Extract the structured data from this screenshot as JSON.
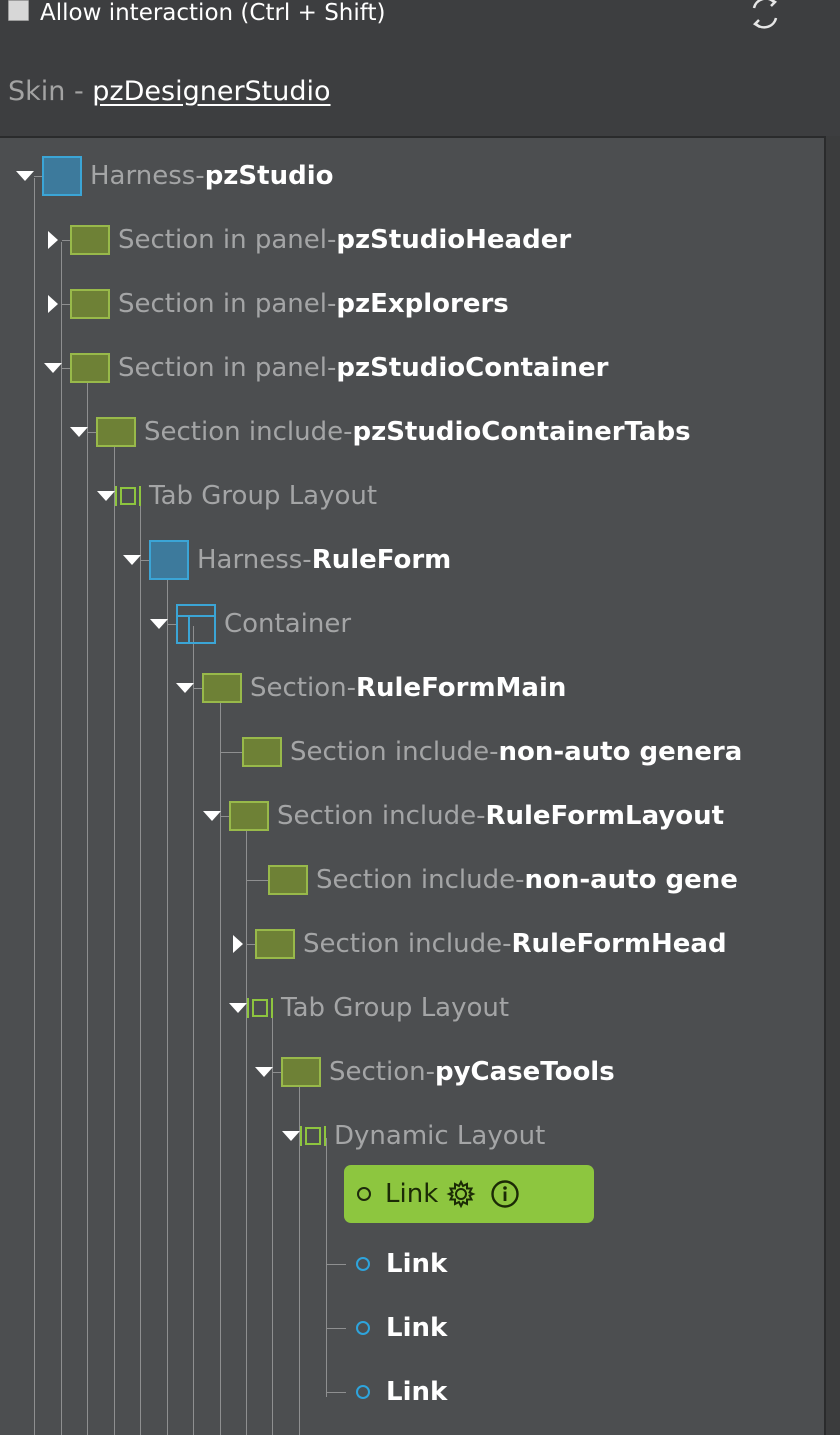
{
  "header": {
    "allow_interaction_label": "Allow interaction (Ctrl + Shift)",
    "allow_interaction_checked": false,
    "skin_prefix": "Skin - ",
    "skin_name": "pzDesignerStudio",
    "refresh_icon": "refresh-icon"
  },
  "tree": {
    "separator": " - ",
    "nodes": [
      {
        "type": "Harness",
        "name": "pzStudio",
        "icon": "harness-icon",
        "expander": "expanded"
      },
      {
        "type": "Section in panel",
        "name": "pzStudioHeader",
        "icon": "section-icon",
        "expander": "collapsed"
      },
      {
        "type": "Section in panel",
        "name": "pzExplorers",
        "icon": "section-icon",
        "expander": "collapsed"
      },
      {
        "type": "Section in panel",
        "name": "pzStudioContainer",
        "icon": "section-icon",
        "expander": "expanded"
      },
      {
        "type": "Section include",
        "name": "pzStudioContainerTabs",
        "icon": "section-icon",
        "expander": "expanded"
      },
      {
        "type": "Tab Group Layout",
        "name": "",
        "icon": "layout-icon",
        "expander": "expanded"
      },
      {
        "type": "Harness",
        "name": "RuleForm",
        "icon": "harness-icon",
        "expander": "expanded"
      },
      {
        "type": "Container",
        "name": "",
        "icon": "container-icon",
        "expander": "expanded"
      },
      {
        "type": "Section",
        "name": "RuleFormMain",
        "icon": "section-icon",
        "expander": "expanded"
      },
      {
        "type": "Section include",
        "name": "non-auto genera",
        "icon": "section-icon",
        "expander": "none"
      },
      {
        "type": "Section include",
        "name": "RuleFormLayout",
        "icon": "section-icon",
        "expander": "expanded"
      },
      {
        "type": "Section include",
        "name": "non-auto gene",
        "icon": "section-icon",
        "expander": "none"
      },
      {
        "type": "Section include",
        "name": "RuleFormHead",
        "icon": "section-icon",
        "expander": "collapsed"
      },
      {
        "type": "Tab Group Layout",
        "name": "",
        "icon": "layout-icon",
        "expander": "expanded"
      },
      {
        "type": "Section",
        "name": "pyCaseTools",
        "icon": "section-icon",
        "expander": "expanded"
      },
      {
        "type": "Dynamic Layout",
        "name": "",
        "icon": "layout-icon",
        "expander": "expanded"
      }
    ],
    "selected_link": {
      "label": "Link",
      "gear_icon": "gear-icon",
      "info_icon": "info-icon"
    },
    "links": [
      "Link",
      "Link",
      "Link"
    ]
  },
  "colors": {
    "selected_highlight": "#8dc63f",
    "section_icon": "#6e8136",
    "harness_icon": "#3d7a9c",
    "link_dot": "#2ea4dc"
  }
}
